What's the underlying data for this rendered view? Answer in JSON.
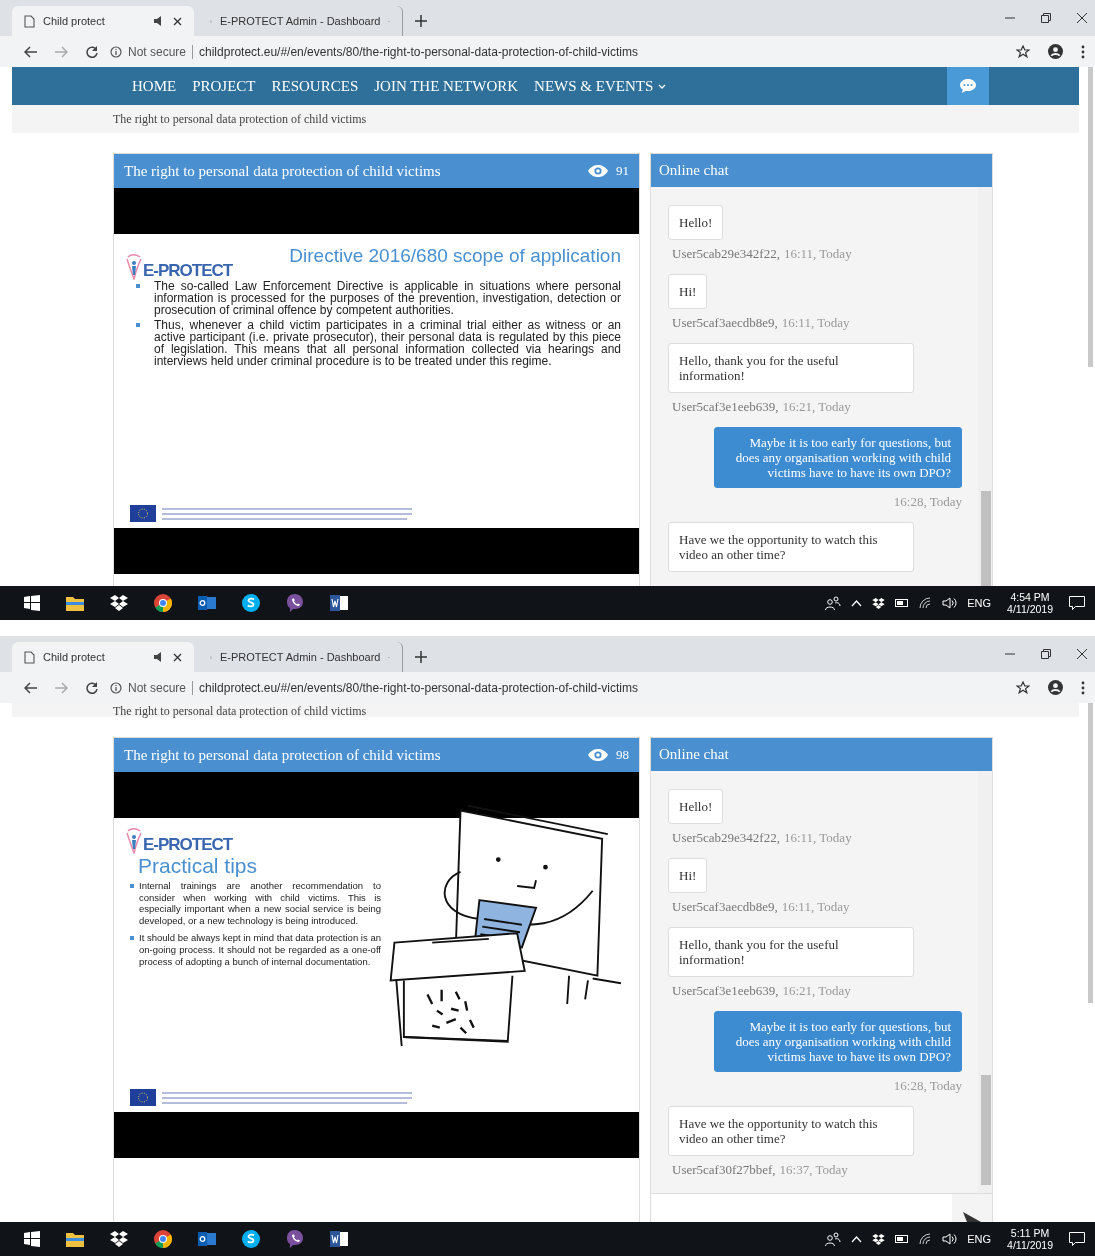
{
  "screens": [
    {
      "browser": {
        "tabs": [
          {
            "title": "Child protect",
            "selected": true,
            "audio": true
          },
          {
            "title": "E-PROTECT Admin - Dashboard",
            "selected": false,
            "audio": false
          }
        ],
        "security": "Not secure",
        "url": "childprotect.eu/#/en/events/80/the-right-to-personal-data-protection-of-child-victims"
      },
      "nav": {
        "items": [
          {
            "label": "HOME",
            "dropdown": false
          },
          {
            "label": "PROJECT",
            "dropdown": false
          },
          {
            "label": "RESOURCES",
            "dropdown": false
          },
          {
            "label": "JOIN THE NETWORK",
            "dropdown": false
          },
          {
            "label": "NEWS & EVENTS",
            "dropdown": true
          }
        ]
      },
      "breadcrumb": "The right to personal data protection of child victims",
      "video": {
        "title": "The right to personal data protection of child victims",
        "views": "91",
        "slide": {
          "kind": "text",
          "logo": "E-PROTECT",
          "heading": "Directive 2016/680 scope of application",
          "bullets": [
            "The so-called Law Enforcement Directive is applicable in situations where personal information is processed for the purposes of the prevention, investigation, detection or prosecution of criminal offence by competent authorities.",
            "Thus, whenever a child victim participates in a criminal trial either as witness or an active participant (i.e. private prosecutor), their personal data is regulated by this piece of legislation. This means that all personal information collected via hearings and interviews held under criminal procedure is to be treated under this regime."
          ]
        }
      },
      "chat": {
        "title": "Online chat",
        "messages": [
          {
            "kind": "received",
            "text": "Hello!",
            "author": "User5cab29e342f22,",
            "time": "16:11, Today"
          },
          {
            "kind": "received",
            "text": "Hi!",
            "author": "User5caf3aecdb8e9,",
            "time": "16:11, Today"
          },
          {
            "kind": "received",
            "text": "Hello, thank you for the useful information!",
            "author": "User5caf3e1eeb639,",
            "time": "16:21, Today"
          },
          {
            "kind": "sent",
            "text": "Maybe it is too early for questions, but does any organisation working with child victims have to have its own DPO?",
            "time": "16:28, Today"
          },
          {
            "kind": "received",
            "text": "Have we the opportunity to watch this video an other time?"
          }
        ]
      },
      "taskbar": {
        "time": "4:54 PM",
        "date": "4/11/2019",
        "language": "ENG"
      }
    },
    {
      "browser": {
        "tabs": [
          {
            "title": "Child protect",
            "selected": true,
            "audio": true
          },
          {
            "title": "E-PROTECT Admin - Dashboard",
            "selected": false,
            "audio": false
          }
        ],
        "security": "Not secure",
        "url": "childprotect.eu/#/en/events/80/the-right-to-personal-data-protection-of-child-victims"
      },
      "breadcrumb": "The right to personal data protection of child victims",
      "video": {
        "title": "The right to personal data protection of child victims",
        "views": "98",
        "slide": {
          "kind": "illustrated",
          "logo": "E-PROTECT",
          "heading": "Practical tips",
          "bullets": [
            "Internal trainings are another recommendation to consider when working with child victims. This is especially important when a new social service is being developed, or a new technology is being introduced.",
            "It should be always kept in mind that data protection is an on-going process. It should not be regarded as a one-off process of adopting a bunch of internal documentation."
          ]
        }
      },
      "chat": {
        "title": "Online chat",
        "composer": true,
        "messages": [
          {
            "kind": "received",
            "text": "Hello!",
            "author": "User5cab29e342f22,",
            "time": "16:11, Today"
          },
          {
            "kind": "received",
            "text": "Hi!",
            "author": "User5caf3aecdb8e9,",
            "time": "16:11, Today"
          },
          {
            "kind": "received",
            "text": "Hello, thank you for the useful information!",
            "author": "User5caf3e1eeb639,",
            "time": "16:21, Today"
          },
          {
            "kind": "sent",
            "text": "Maybe it is too early for questions, but does any organisation working with child victims have to have its own DPO?",
            "time": "16:28, Today"
          },
          {
            "kind": "received",
            "text": "Have we the opportunity to watch this video an other time?",
            "author": "User5caf30f27bbef,",
            "time": "16:37, Today"
          }
        ]
      },
      "taskbar": {
        "time": "5:11 PM",
        "date": "4/11/2019",
        "language": "ENG"
      }
    }
  ]
}
